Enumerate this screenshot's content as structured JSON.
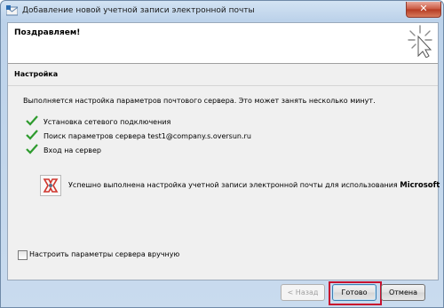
{
  "window": {
    "title": "Добавление новой учетной записи электронной почты",
    "close_glyph": "✕"
  },
  "header": {
    "congrats": "Поздравляем!"
  },
  "section": {
    "title": "Настройка",
    "intro": "Выполняется настройка параметров почтового сервера. Это может занять несколько минут.",
    "steps": [
      "Установка сетевого подключения",
      "Поиск параметров сервера test1@company.s.oversun.ru",
      "Вход на сервер"
    ],
    "success_prefix": "Успешно выполнена настройка учетной записи электронной почты для использования",
    "success_product": "Microsoft Exchange",
    "success_suffix": ".",
    "manual_label": "Настроить параметры сервера вручную",
    "manual_checked": false
  },
  "buttons": {
    "back": "< Назад",
    "finish": "Готово",
    "cancel": "Отмена"
  },
  "icons": {
    "app": "outlook-app-icon",
    "wizard": "wizard-sparkle-icon",
    "step": "checkmark-icon",
    "success": "exchange-logo-icon"
  },
  "colors": {
    "check": "#2e9b2e",
    "highlight": "#c8102e"
  }
}
